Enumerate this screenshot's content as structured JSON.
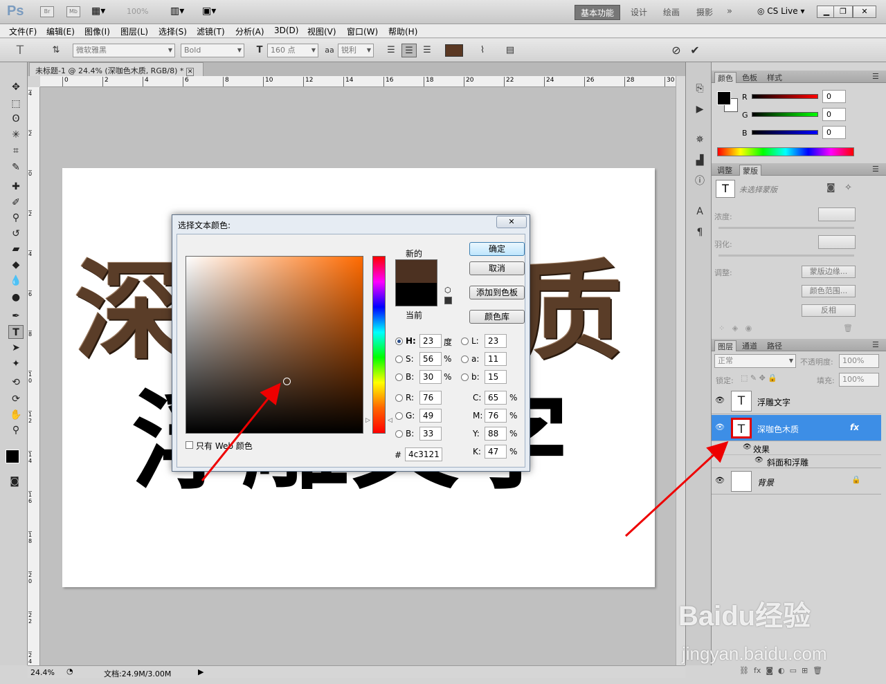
{
  "app": {
    "logo": "Ps",
    "icons": [
      "Br",
      "Mb"
    ],
    "zoom": "100%",
    "cs_live": "CS Live"
  },
  "workspaces": [
    "基本功能",
    "设计",
    "绘画",
    "摄影"
  ],
  "menus": [
    "文件(F)",
    "编辑(E)",
    "图像(I)",
    "图层(L)",
    "选择(S)",
    "滤镜(T)",
    "分析(A)",
    "3D(D)",
    "视图(V)",
    "窗口(W)",
    "帮助(H)"
  ],
  "options": {
    "font_family": "微软雅黑",
    "font_style": "Bold",
    "font_size": "160 点",
    "aa_label": "aa",
    "antialias": "锐利",
    "text_color": "#5a3823"
  },
  "document": {
    "tab_title": "未标题-1 @ 24.4% (深咖色木质, RGB/8) *",
    "text_line1": "深咖色木质",
    "text_line2": "浮雕文字",
    "ruler_top": [
      "0",
      "2",
      "4",
      "6",
      "8",
      "10",
      "12",
      "14",
      "16",
      "18",
      "20",
      "22",
      "24",
      "26",
      "28",
      "30"
    ],
    "ruler_left": [
      "4",
      "2",
      "0",
      "2",
      "4",
      "6",
      "8",
      "1\n0",
      "1\n2",
      "1\n4",
      "1\n6",
      "1\n8",
      "2\n0",
      "2\n2",
      "2\n4"
    ]
  },
  "status": {
    "zoom": "24.4%",
    "doc_size": "文档:24.9M/3.00M"
  },
  "color_panel": {
    "tabs": [
      "颜色",
      "色板",
      "样式"
    ],
    "channels": [
      {
        "label": "R",
        "value": "0"
      },
      {
        "label": "G",
        "value": "0"
      },
      {
        "label": "B",
        "value": "0"
      }
    ]
  },
  "masks_panel": {
    "tabs": [
      "调整",
      "蒙版"
    ],
    "no_mask": "未选择蒙版",
    "density": "浓度:",
    "feather": "羽化:",
    "adjust": "调整:",
    "buttons": [
      "蒙版边缘...",
      "颜色范围...",
      "反相"
    ]
  },
  "layers_panel": {
    "tabs": [
      "图层",
      "通道",
      "路径"
    ],
    "blend_mode": "正常",
    "opacity_label": "不透明度:",
    "opacity": "100%",
    "lock_label": "锁定:",
    "fill_label": "填充:",
    "fill": "100%",
    "layers": [
      {
        "name": "浮雕文字"
      },
      {
        "name": "深咖色木质",
        "fx": "fx"
      },
      {
        "name": "背景"
      }
    ],
    "effects_label": "效果",
    "effect": "斜面和浮雕"
  },
  "dialog": {
    "title": "选择文本颜色:",
    "new_label": "新的",
    "current_label": "当前",
    "new_color": "#4c3121",
    "current_color": "#000000",
    "buttons": {
      "ok": "确定",
      "cancel": "取消",
      "add_swatch": "添加到色板",
      "libraries": "颜色库"
    },
    "web_only": "只有 Web 颜色",
    "fields_left": [
      {
        "label": "H:",
        "value": "23",
        "unit": "度"
      },
      {
        "label": "S:",
        "value": "56",
        "unit": "%"
      },
      {
        "label": "B:",
        "value": "30",
        "unit": "%"
      },
      {
        "label": "R:",
        "value": "76",
        "unit": ""
      },
      {
        "label": "G:",
        "value": "49",
        "unit": ""
      },
      {
        "label": "B:",
        "value": "33",
        "unit": ""
      }
    ],
    "fields_right": [
      {
        "label": "L:",
        "value": "23",
        "unit": ""
      },
      {
        "label": "a:",
        "value": "11",
        "unit": ""
      },
      {
        "label": "b:",
        "value": "15",
        "unit": ""
      },
      {
        "label": "C:",
        "value": "65",
        "unit": "%"
      },
      {
        "label": "M:",
        "value": "76",
        "unit": "%"
      },
      {
        "label": "Y:",
        "value": "88",
        "unit": "%"
      },
      {
        "label": "K:",
        "value": "47",
        "unit": "%"
      }
    ],
    "hex_label": "#",
    "hex": "4c3121"
  },
  "watermark": {
    "brand": "Baidu经验",
    "url": "jingyan.baidu.com"
  }
}
